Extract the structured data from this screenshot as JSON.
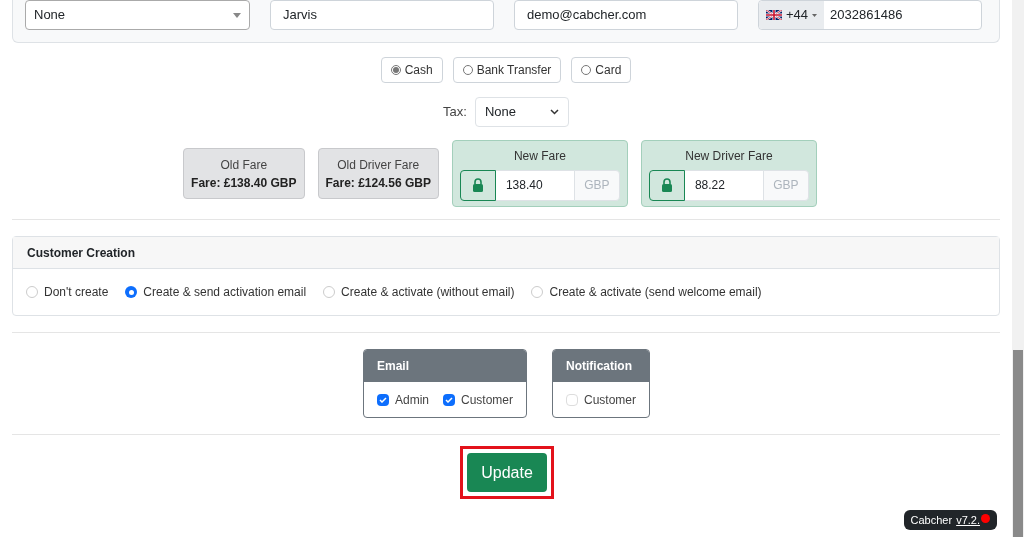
{
  "contact": {
    "account": "None",
    "name": "Jarvis",
    "email": "demo@cabcher.com",
    "phone_code": "+44",
    "phone": "2032861486"
  },
  "payment_methods": [
    {
      "label": "Cash",
      "selected": true
    },
    {
      "label": "Bank Transfer",
      "selected": false
    },
    {
      "label": "Card",
      "selected": false
    }
  ],
  "tax": {
    "label": "Tax:",
    "value": "None"
  },
  "fares": [
    {
      "kind": "static",
      "title": "Old Fare",
      "value": "Fare: £138.40 GBP"
    },
    {
      "kind": "static",
      "title": "Old Driver Fare",
      "value": "Fare: £124.56 GBP"
    },
    {
      "kind": "editable",
      "title": "New Fare",
      "value": "138.40",
      "currency": "GBP"
    },
    {
      "kind": "editable",
      "title": "New Driver Fare",
      "value": "88.22",
      "currency": "GBP"
    }
  ],
  "customer_creation": {
    "title": "Customer Creation",
    "options": [
      {
        "label": "Don't create",
        "selected": false
      },
      {
        "label": "Create & send activation email",
        "selected": true
      },
      {
        "label": "Create & activate (without email)",
        "selected": false
      },
      {
        "label": "Create & activate (send welcome email)",
        "selected": false
      }
    ]
  },
  "groups": [
    {
      "title": "Email",
      "options": [
        {
          "label": "Admin",
          "checked": true
        },
        {
          "label": "Customer",
          "checked": true
        }
      ]
    },
    {
      "title": "Notification",
      "options": [
        {
          "label": "Customer",
          "checked": false
        }
      ]
    }
  ],
  "update_button": "Update",
  "version_badge": {
    "app": "Cabcher",
    "version": "v7.2."
  }
}
